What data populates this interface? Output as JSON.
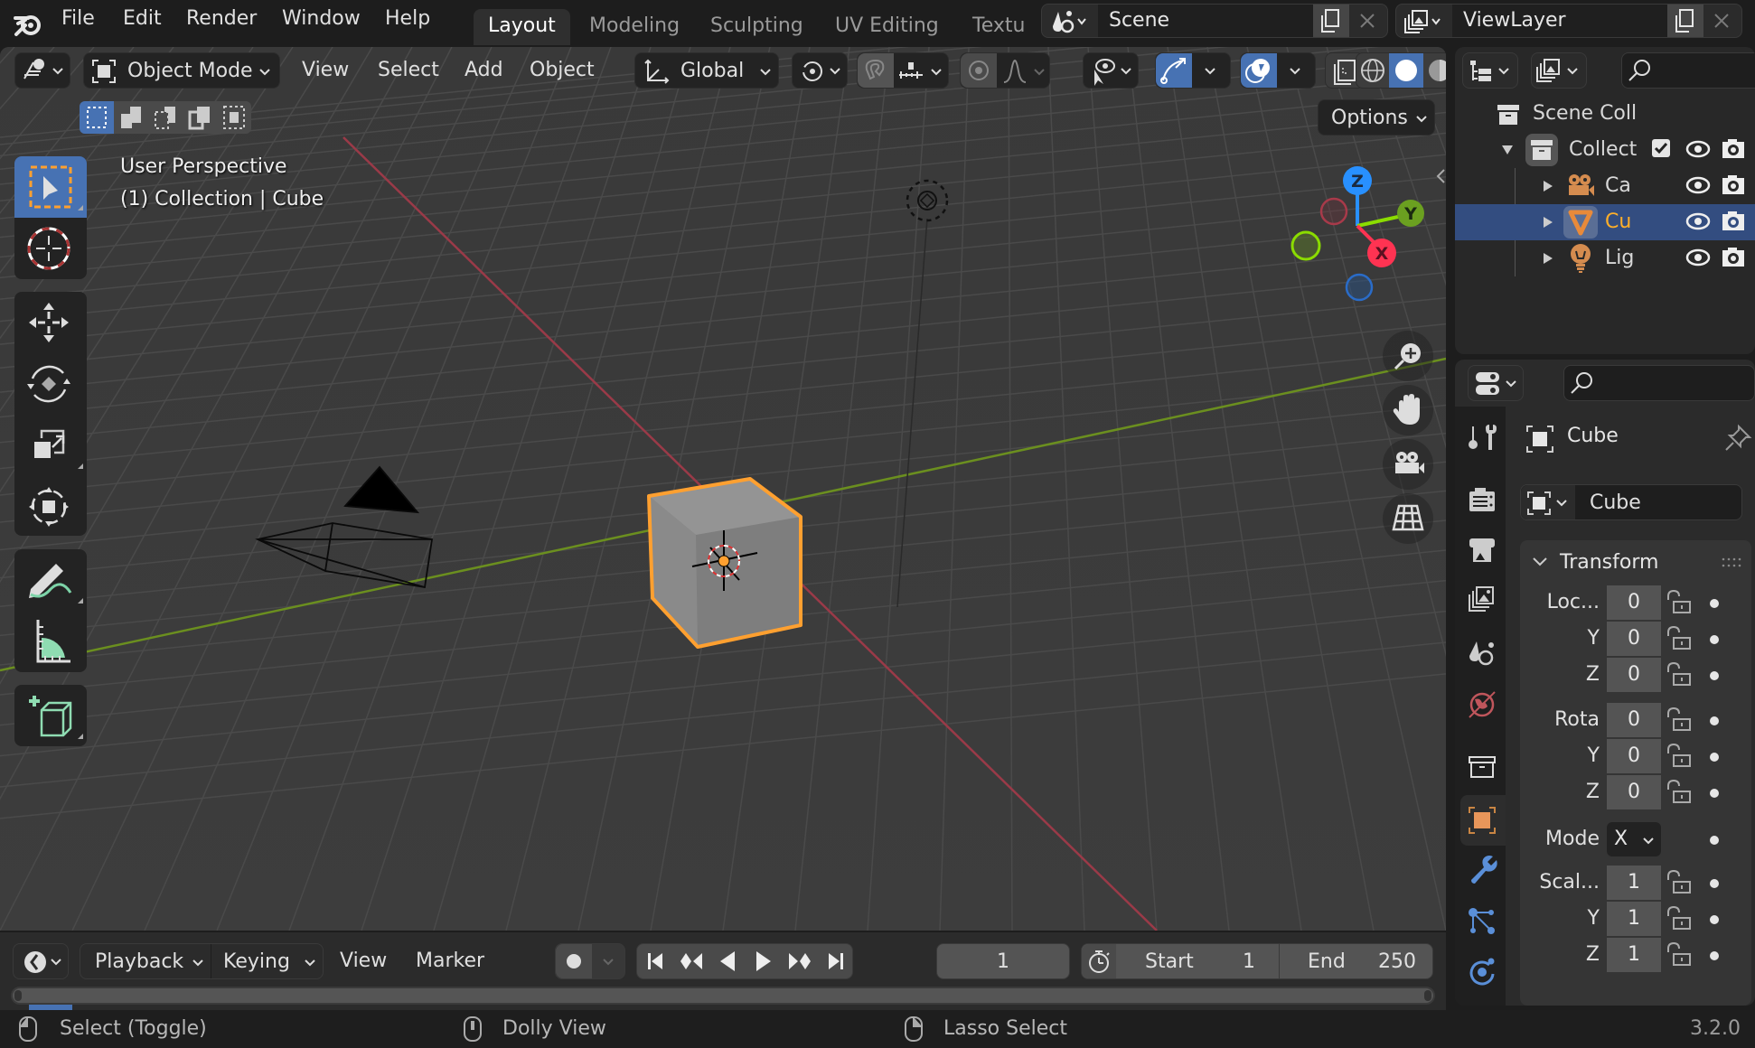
{
  "topbar": {
    "menus": [
      "File",
      "Edit",
      "Render",
      "Window",
      "Help"
    ],
    "workspaces": [
      {
        "label": "Layout",
        "active": true
      },
      {
        "label": "Modeling",
        "active": false
      },
      {
        "label": "Sculpting",
        "active": false
      },
      {
        "label": "UV Editing",
        "active": false
      },
      {
        "label": "Textu",
        "active": false
      }
    ],
    "scene": "Scene",
    "view_layer": "ViewLayer"
  },
  "viewport": {
    "mode": "Object Mode",
    "menus": [
      "View",
      "Select",
      "Add",
      "Object"
    ],
    "orientation": "Global",
    "options_label": "Options",
    "overlay_title": "User Perspective",
    "overlay_subtitle": "(1) Collection | Cube",
    "gizmo_axes": {
      "x": "X",
      "y": "Y",
      "z": "Z"
    },
    "colors": {
      "x_axis": "#ff3352",
      "y_axis": "#8bdc00",
      "z_axis": "#2890ff",
      "selection": "#ffa030",
      "active_blue": "#4772b3"
    }
  },
  "outliner": {
    "root": "Scene Coll",
    "collection": "Collect",
    "items": [
      {
        "label": "Ca",
        "icon": "camera-icon",
        "selected": false
      },
      {
        "label": "Cu",
        "icon": "mesh-icon",
        "selected": true
      },
      {
        "label": "Lig",
        "icon": "light-icon",
        "selected": false
      }
    ]
  },
  "properties": {
    "object_name": "Cube",
    "datablock_name": "Cube",
    "panel_title": "Transform",
    "location": {
      "label": "Loc...",
      "x": "0",
      "y": "0",
      "z": "0"
    },
    "rotation": {
      "label": "Rota",
      "x": "0",
      "y": "0",
      "z": "0"
    },
    "mode": {
      "label": "Mode",
      "value": "X"
    },
    "scale": {
      "label": "Scal...",
      "x": "1",
      "y": "1",
      "z": "1"
    },
    "axis_labels": {
      "y": "Y",
      "z": "Z"
    }
  },
  "timeline": {
    "menus": [
      "Playback",
      "Keying",
      "View",
      "Marker"
    ],
    "current_frame": "1",
    "start_label": "Start",
    "start": "1",
    "end_label": "End",
    "end": "250"
  },
  "statusbar": {
    "left": "Select (Toggle)",
    "middle": "Dolly View",
    "right": "Lasso Select",
    "version": "3.2.0"
  }
}
